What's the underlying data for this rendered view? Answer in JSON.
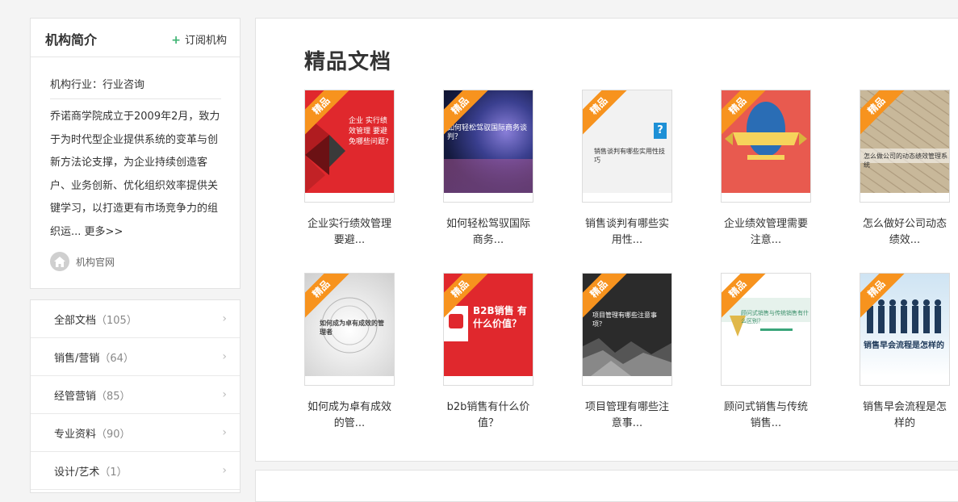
{
  "intro": {
    "title": "机构简介",
    "subscribe": "订阅机构",
    "industry": "机构行业：行业咨询",
    "description": "乔诺商学院成立于2009年2月，致力于为时代型企业提供系统的变革与创新方法论支撑，为企业持续创造客户、业务创新、优化组织效率提供关键学习，以打造更有市场竞争力的组织运...",
    "more": "更多>>",
    "official_site": "机构官网"
  },
  "categories": [
    {
      "label": "全部文档",
      "count": "（105）"
    },
    {
      "label": "销售/营销",
      "count": "（64）"
    },
    {
      "label": "经管营销",
      "count": "（85）"
    },
    {
      "label": "专业资料",
      "count": "（90）"
    },
    {
      "label": "设计/艺术",
      "count": "（1）"
    }
  ],
  "main": {
    "title": "精品文档",
    "badge": "精品",
    "docs": [
      {
        "line1": "企业实行绩效管理",
        "line2": "要避...",
        "cover": "企业 实行绩效管理 要避免哪些问题?",
        "color": "#e0282d"
      },
      {
        "line1": "如何轻松驾驭国际",
        "line2": "商务...",
        "cover": "如何轻松驾驭国际商务谈判？",
        "color": "#3a3f8f"
      },
      {
        "line1": "销售谈判有哪些实",
        "line2": "用性...",
        "cover": "销售谈判有哪些实用性技巧",
        "color": "#f2f2f2"
      },
      {
        "line1": "企业绩效管理需要",
        "line2": "注意...",
        "cover": "",
        "color": "#e85a4f"
      },
      {
        "line1": "怎么做好公司动态",
        "line2": "绩效...",
        "cover": "怎么做公司的动态绩效管理系统",
        "color": "#c8b89a"
      },
      {
        "line1": "如何成为卓有成效",
        "line2": "的管...",
        "cover": "如何成为卓有成效的管理者",
        "color": "#e8e8e8"
      },
      {
        "line1": "b2b销售有什么价",
        "line2": "值？",
        "cover": "B2B销售 有什么价值？",
        "color": "#e0282d"
      },
      {
        "line1": "项目管理有哪些注",
        "line2": "意事...",
        "cover": "项目管理有哪些注意事项？",
        "color": "#2b2b2b"
      },
      {
        "line1": "顾问式销售与传统",
        "line2": "销售...",
        "cover": "顾问式销售与传统销售有什么区别？",
        "color": "#ffffff"
      },
      {
        "line1": "销售早会流程是怎",
        "line2": "样的",
        "cover": "销售早会流程是怎样的",
        "color": "#cfe4f3"
      }
    ]
  }
}
